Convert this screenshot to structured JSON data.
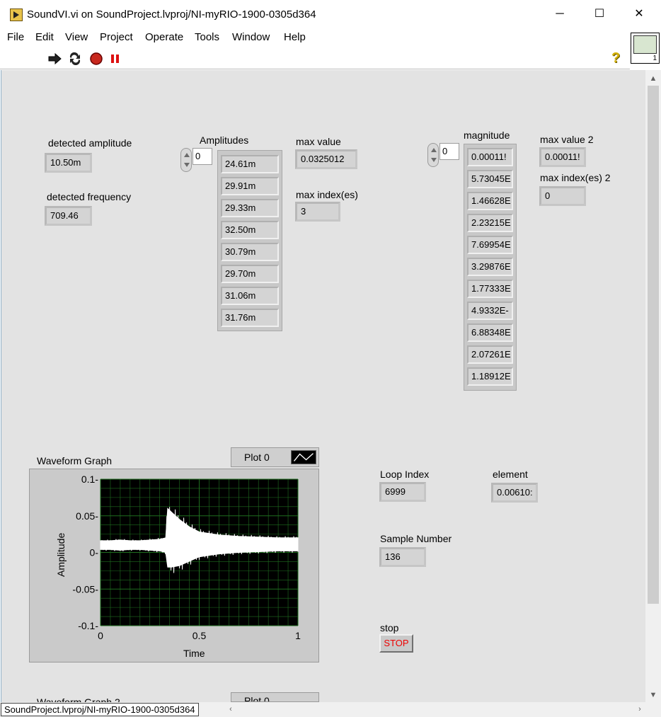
{
  "window": {
    "title": "SoundVI.vi on SoundProject.lvproj/NI-myRIO-1900-0305d364",
    "minimize": "─",
    "maximize": "☐",
    "close": "✕"
  },
  "menu": [
    "File",
    "Edit",
    "View",
    "Project",
    "Operate",
    "Tools",
    "Window",
    "Help"
  ],
  "toolbar": {
    "run_icon": "run-arrow-icon",
    "run_continuous_icon": "run-continuously-icon",
    "abort_icon": "abort-icon",
    "pause_icon": "pause-icon",
    "help_icon": "context-help-icon",
    "help_glyph": "?",
    "connector_number": "1"
  },
  "indicators": {
    "detected_amplitude": {
      "label": "detected amplitude",
      "value": "10.50m"
    },
    "detected_frequency": {
      "label": "detected frequency",
      "value": "709.46"
    },
    "max_value": {
      "label": "max value",
      "value": "0.0325012"
    },
    "max_indexes": {
      "label": "max index(es)",
      "value": "3"
    },
    "max_value_2": {
      "label": "max value 2",
      "value": "0.00011!"
    },
    "max_indexes_2": {
      "label": "max index(es) 2",
      "value": "0"
    },
    "loop_index": {
      "label": "Loop Index",
      "value": "6999"
    },
    "element": {
      "label": "element",
      "value": "0.00610:"
    },
    "sample_number": {
      "label": "Sample  Number",
      "value": "136"
    }
  },
  "amplitudes": {
    "label": "Amplitudes",
    "index": "0",
    "values": [
      "24.61m",
      "29.91m",
      "29.33m",
      "32.50m",
      "30.79m",
      "29.70m",
      "31.06m",
      "31.76m"
    ]
  },
  "magnitude": {
    "label": "magnitude",
    "index": "0",
    "values": [
      "0.00011!",
      "5.73045E",
      "1.46628E",
      "2.23215E",
      "7.69954E",
      "3.29876E",
      "1.77333E",
      "4.9332E-",
      "6.88348E",
      "2.07261E",
      "1.18912E"
    ]
  },
  "stop": {
    "label": "stop",
    "button": "STOP"
  },
  "graph": {
    "title": "Waveform Graph",
    "legend": "Plot 0",
    "xlabel": "Time",
    "ylabel": "Amplitude",
    "xticks": [
      "0",
      "0.5",
      "1"
    ],
    "yticks": [
      "0.1-",
      "0.05-",
      "0-",
      "-0.05-",
      "-0.1-"
    ]
  },
  "graph2": {
    "title": "Waveform Graph 2",
    "legend": "Plot 0"
  },
  "chart_data": {
    "type": "line",
    "x": [
      0,
      0.05,
      0.1,
      0.15,
      0.2,
      0.25,
      0.3,
      0.33,
      0.34,
      0.36,
      0.4,
      0.45,
      0.5,
      0.55,
      0.6,
      0.7,
      0.8,
      0.9,
      1.0
    ],
    "series": [
      {
        "upper": [
          0.016,
          0.016,
          0.017,
          0.016,
          0.016,
          0.017,
          0.018,
          0.02,
          0.06,
          0.055,
          0.045,
          0.035,
          0.028,
          0.026,
          0.024,
          0.022,
          0.021,
          0.02,
          0.02
        ],
        "lower": [
          0.004,
          0.004,
          0.003,
          0.004,
          0.004,
          0.003,
          0.002,
          0.0,
          -0.02,
          -0.02,
          -0.018,
          -0.012,
          -0.006,
          -0.004,
          -0.002,
          0.0,
          0.001,
          0.002,
          0.002
        ]
      }
    ],
    "xlim": [
      0,
      1
    ],
    "ylim": [
      -0.1,
      0.1
    ],
    "grid": true,
    "background": "#000000",
    "grid_color": "#1f6e1f",
    "line_color": "#ffffff"
  },
  "status_bar": {
    "path": "SoundProject.lvproj/NI-myRIO-1900-0305d364"
  },
  "scroll": {
    "up": "▲",
    "down": "▼",
    "left": "◀",
    "right": "▶",
    "h_left": "‹",
    "h_right": "›"
  }
}
